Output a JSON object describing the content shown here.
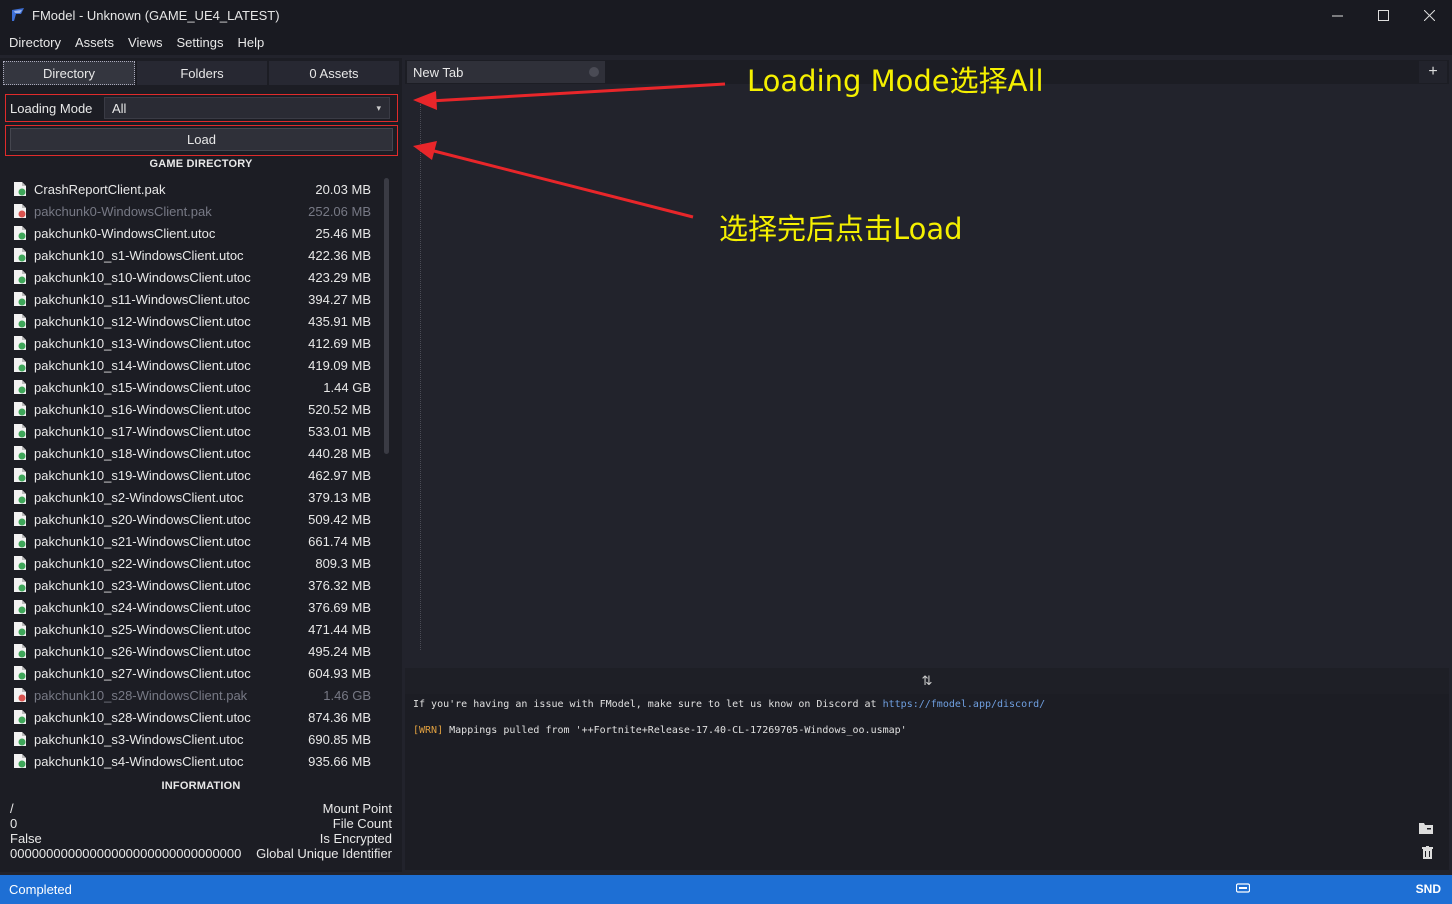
{
  "window": {
    "title": "FModel - Unknown (GAME_UE4_LATEST)",
    "minimize": "—",
    "maximize": "☐",
    "close": "✕"
  },
  "menu": [
    "Directory",
    "Assets",
    "Views",
    "Settings",
    "Help"
  ],
  "left_tabs": [
    "Directory",
    "Folders",
    "0 Assets"
  ],
  "loading": {
    "label": "Loading Mode",
    "value": "All",
    "caret": "▾",
    "load_button": "Load"
  },
  "game_directory": {
    "header": "GAME DIRECTORY",
    "files": [
      {
        "name": "CrashReportClient.pak",
        "size": "20.03 MB",
        "dim": false
      },
      {
        "name": "pakchunk0-WindowsClient.pak",
        "size": "252.06 MB",
        "dim": true
      },
      {
        "name": "pakchunk0-WindowsClient.utoc",
        "size": "25.46 MB",
        "dim": false
      },
      {
        "name": "pakchunk10_s1-WindowsClient.utoc",
        "size": "422.36 MB",
        "dim": false
      },
      {
        "name": "pakchunk10_s10-WindowsClient.utoc",
        "size": "423.29 MB",
        "dim": false
      },
      {
        "name": "pakchunk10_s11-WindowsClient.utoc",
        "size": "394.27 MB",
        "dim": false
      },
      {
        "name": "pakchunk10_s12-WindowsClient.utoc",
        "size": "435.91 MB",
        "dim": false
      },
      {
        "name": "pakchunk10_s13-WindowsClient.utoc",
        "size": "412.69 MB",
        "dim": false
      },
      {
        "name": "pakchunk10_s14-WindowsClient.utoc",
        "size": "419.09 MB",
        "dim": false
      },
      {
        "name": "pakchunk10_s15-WindowsClient.utoc",
        "size": "1.44 GB",
        "dim": false
      },
      {
        "name": "pakchunk10_s16-WindowsClient.utoc",
        "size": "520.52 MB",
        "dim": false
      },
      {
        "name": "pakchunk10_s17-WindowsClient.utoc",
        "size": "533.01 MB",
        "dim": false
      },
      {
        "name": "pakchunk10_s18-WindowsClient.utoc",
        "size": "440.28 MB",
        "dim": false
      },
      {
        "name": "pakchunk10_s19-WindowsClient.utoc",
        "size": "462.97 MB",
        "dim": false
      },
      {
        "name": "pakchunk10_s2-WindowsClient.utoc",
        "size": "379.13 MB",
        "dim": false
      },
      {
        "name": "pakchunk10_s20-WindowsClient.utoc",
        "size": "509.42 MB",
        "dim": false
      },
      {
        "name": "pakchunk10_s21-WindowsClient.utoc",
        "size": "661.74 MB",
        "dim": false
      },
      {
        "name": "pakchunk10_s22-WindowsClient.utoc",
        "size": "809.3 MB",
        "dim": false
      },
      {
        "name": "pakchunk10_s23-WindowsClient.utoc",
        "size": "376.32 MB",
        "dim": false
      },
      {
        "name": "pakchunk10_s24-WindowsClient.utoc",
        "size": "376.69 MB",
        "dim": false
      },
      {
        "name": "pakchunk10_s25-WindowsClient.utoc",
        "size": "471.44 MB",
        "dim": false
      },
      {
        "name": "pakchunk10_s26-WindowsClient.utoc",
        "size": "495.24 MB",
        "dim": false
      },
      {
        "name": "pakchunk10_s27-WindowsClient.utoc",
        "size": "604.93 MB",
        "dim": false
      },
      {
        "name": "pakchunk10_s28-WindowsClient.pak",
        "size": "1.46 GB",
        "dim": true
      },
      {
        "name": "pakchunk10_s28-WindowsClient.utoc",
        "size": "874.36 MB",
        "dim": false
      },
      {
        "name": "pakchunk10_s3-WindowsClient.utoc",
        "size": "690.85 MB",
        "dim": false
      },
      {
        "name": "pakchunk10_s4-WindowsClient.utoc",
        "size": "935.66 MB",
        "dim": false
      }
    ]
  },
  "information": {
    "header": "INFORMATION",
    "rows": [
      {
        "value": "/",
        "label": "Mount Point"
      },
      {
        "value": "0",
        "label": "File Count"
      },
      {
        "value": "False",
        "label": "Is Encrypted"
      },
      {
        "value": "00000000000000000000000000000000",
        "label": "Global Unique Identifier"
      }
    ]
  },
  "document_tabs": {
    "tab": "New Tab",
    "add": "+"
  },
  "splitter_icon": "⇅",
  "log": {
    "line1_prefix": "If you're having an issue with FModel, make sure to let us know on Discord at ",
    "line1_link": "https://fmodel.app/discord/",
    "line2_tag": "[WRN]",
    "line2_text": " Mappings pulled from '++Fortnite+Release-17.40-CL-17269705-Windows_oo.usmap'",
    "folder_icon": "▰",
    "trash_icon": "🗑"
  },
  "status": {
    "text": "Completed",
    "right": "SND"
  },
  "annotations": {
    "loading_mode": "Loading Mode选择All",
    "load_hint": "选择完后点击Load"
  },
  "colors": {
    "accent": "#1e6fd4",
    "annotation_arrow": "#e8262a",
    "annotation_text": "#f5f000",
    "file_icon_green": "#3fa65a",
    "file_icon_red": "#d9534f"
  }
}
